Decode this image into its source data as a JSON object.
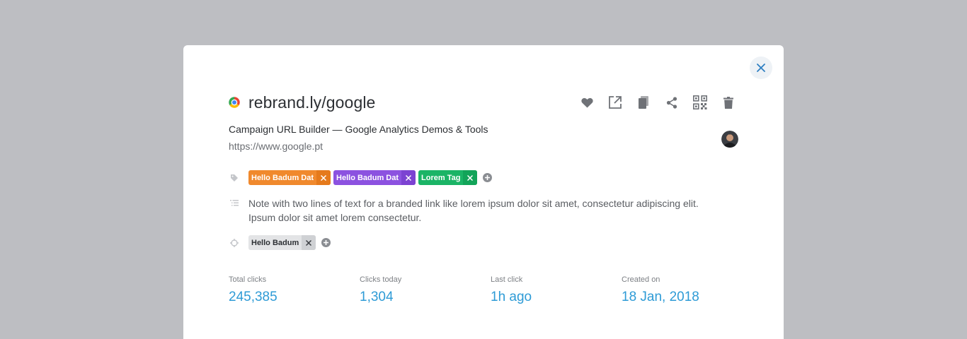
{
  "link": {
    "short_url": "rebrand.ly/google",
    "page_title": "Campaign URL Builder — Google Analytics Demos & Tools",
    "destination": "https://www.google.pt"
  },
  "actions": [
    {
      "name": "favorite",
      "icon": "heart-icon"
    },
    {
      "name": "open",
      "icon": "external-link-icon"
    },
    {
      "name": "copy",
      "icon": "copy-icon"
    },
    {
      "name": "share",
      "icon": "share-icon"
    },
    {
      "name": "qr-code",
      "icon": "qr-code-icon"
    },
    {
      "name": "delete",
      "icon": "trash-icon"
    }
  ],
  "tags": [
    {
      "label": "Hello Badum Dat",
      "color": "#f0892d"
    },
    {
      "label": "Hello Badum Dat",
      "color": "#8c52e0"
    },
    {
      "label": "Lorem Tag",
      "color": "#1bb466"
    }
  ],
  "note": {
    "line1": "Note with two lines of text for a branded link like lorem ipsum dolor sit amet, consectetur adipiscing elit.",
    "line2": "Ipsum dolor sit amet lorem consectetur."
  },
  "retargeting": [
    {
      "label": "Hello Badum"
    }
  ],
  "stats": [
    {
      "label": "Total clicks",
      "value": "245,385"
    },
    {
      "label": "Clicks today",
      "value": "1,304"
    },
    {
      "label": "Last click",
      "value": "1h ago"
    },
    {
      "label": "Created on",
      "value": "18 Jan, 2018"
    }
  ],
  "colors": {
    "accent": "#2e9bd6",
    "backdrop": "#bdbec2"
  }
}
